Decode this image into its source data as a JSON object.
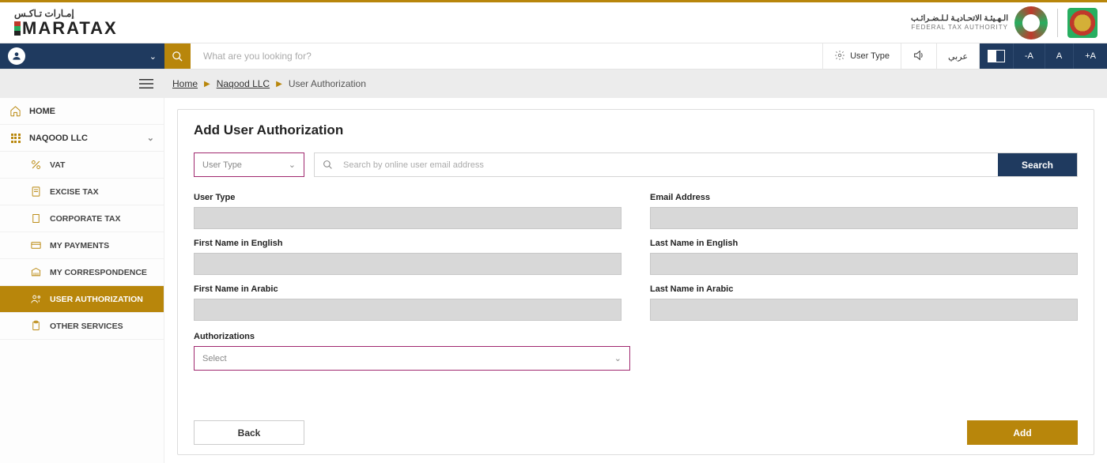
{
  "brand": {
    "arabic": "إمـارات تـاكـس",
    "main": "MARATAX",
    "fta_ar": "الـهـيئـة الاتحـاديـة لـلـضـرائـب",
    "fta_en": "FEDERAL TAX AUTHORITY"
  },
  "toolbar": {
    "search_placeholder": "What are you looking for?",
    "user_type": "User Type",
    "lang": "عربي",
    "minus_a": "-A",
    "a": "A",
    "plus_a": "+A"
  },
  "breadcrumb": {
    "home": "Home",
    "mid": "Naqood LLC",
    "current": "User Authorization"
  },
  "sidebar": {
    "home": "HOME",
    "company": "NAQOOD LLC",
    "items": {
      "vat": "VAT",
      "excise": "EXCISE TAX",
      "corp": "CORPORATE TAX",
      "payments": "MY PAYMENTS",
      "corr": "MY CORRESPONDENCE",
      "auth": "USER AUTHORIZATION",
      "other": "OTHER SERVICES"
    }
  },
  "page": {
    "title": "Add User Authorization",
    "type_placeholder": "User Type",
    "email_search_placeholder": "Search by online user email address",
    "search_btn": "Search",
    "labels": {
      "user_type": "User Type",
      "email": "Email Address",
      "fn_en": "First Name in English",
      "ln_en": "Last Name in English",
      "fn_ar": "First Name in Arabic",
      "ln_ar": "Last Name in Arabic",
      "auths": "Authorizations"
    },
    "auth_placeholder": "Select",
    "back": "Back",
    "add": "Add"
  }
}
